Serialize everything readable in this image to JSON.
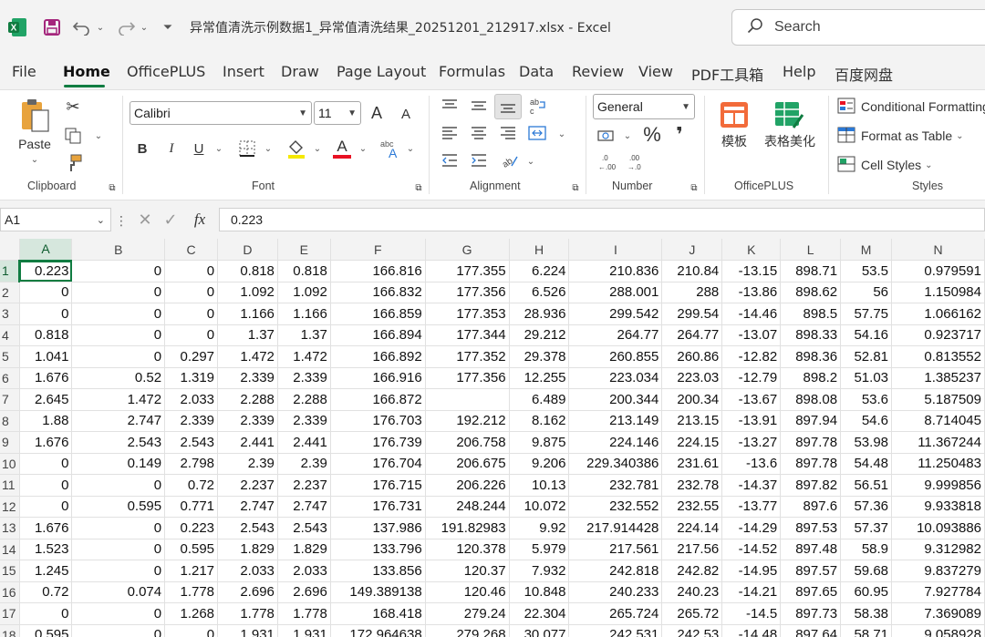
{
  "window": {
    "title": "异常值清洗示例数据1_异常值清洗结果_20251201_212917.xlsx  -  Excel",
    "search_placeholder": "Search"
  },
  "tabs": [
    {
      "label": "File"
    },
    {
      "label": "Home",
      "active": true
    },
    {
      "label": "OfficePLUS"
    },
    {
      "label": "Insert"
    },
    {
      "label": "Draw"
    },
    {
      "label": "Page Layout"
    },
    {
      "label": "Formulas"
    },
    {
      "label": "Data"
    },
    {
      "label": "Review"
    },
    {
      "label": "View"
    },
    {
      "label": "PDF工具箱"
    },
    {
      "label": "Help"
    },
    {
      "label": "百度网盘"
    }
  ],
  "ribbon": {
    "clipboard": {
      "paste_label": "Paste",
      "group_label": "Clipboard"
    },
    "font": {
      "family": "Calibri",
      "size": "11",
      "group_label": "Font",
      "bold": "B",
      "italic": "I",
      "underline": "U",
      "grow": "A",
      "shrink": "A",
      "font_color": "A"
    },
    "alignment": {
      "group_label": "Alignment"
    },
    "number": {
      "format": "General",
      "group_label": "Number",
      "percent": "%",
      "comma": "❜"
    },
    "officeplus": {
      "template_label": "模板",
      "beautify_label": "表格美化",
      "group_label": "OfficePLUS"
    },
    "styles": {
      "conditional": "Conditional Formatting",
      "format_table": "Format as Table",
      "cell_styles": "Cell Styles",
      "group_label": "Styles"
    }
  },
  "formula_bar": {
    "name_box": "A1",
    "fx": "fx",
    "value": "0.223"
  },
  "sheet": {
    "columns": [
      "A",
      "B",
      "C",
      "D",
      "E",
      "F",
      "G",
      "H",
      "I",
      "J",
      "K",
      "L",
      "M",
      "N"
    ],
    "rows": [
      {
        "num": "1",
        "cells": [
          "0.223",
          "0",
          "0",
          "0.818",
          "0.818",
          "166.816",
          "177.355",
          "6.224",
          "210.836",
          "210.84",
          "-13.15",
          "898.71",
          "53.5",
          "0.979591"
        ]
      },
      {
        "num": "2",
        "cells": [
          "0",
          "0",
          "0",
          "1.092",
          "1.092",
          "166.832",
          "177.356",
          "6.526",
          "288.001",
          "288",
          "-13.86",
          "898.62",
          "56",
          "1.150984"
        ]
      },
      {
        "num": "3",
        "cells": [
          "0",
          "0",
          "0",
          "1.166",
          "1.166",
          "166.859",
          "177.353",
          "28.936",
          "299.542",
          "299.54",
          "-14.46",
          "898.5",
          "57.75",
          "1.066162"
        ]
      },
      {
        "num": "4",
        "cells": [
          "0.818",
          "0",
          "0",
          "1.37",
          "1.37",
          "166.894",
          "177.344",
          "29.212",
          "264.77",
          "264.77",
          "-13.07",
          "898.33",
          "54.16",
          "0.923717"
        ]
      },
      {
        "num": "5",
        "cells": [
          "1.041",
          "0",
          "0.297",
          "1.472",
          "1.472",
          "166.892",
          "177.352",
          "29.378",
          "260.855",
          "260.86",
          "-12.82",
          "898.36",
          "52.81",
          "0.813552"
        ]
      },
      {
        "num": "6",
        "cells": [
          "1.676",
          "0.52",
          "1.319",
          "2.339",
          "2.339",
          "166.916",
          "177.356",
          "12.255",
          "223.034",
          "223.03",
          "-12.79",
          "898.2",
          "51.03",
          "1.385237"
        ]
      },
      {
        "num": "7",
        "cells": [
          "2.645",
          "1.472",
          "2.033",
          "2.288",
          "2.288",
          "166.872",
          "",
          "6.489",
          "200.344",
          "200.34",
          "-13.67",
          "898.08",
          "53.6",
          "5.187509"
        ]
      },
      {
        "num": "8",
        "cells": [
          "1.88",
          "2.747",
          "2.339",
          "2.339",
          "2.339",
          "176.703",
          "192.212",
          "8.162",
          "213.149",
          "213.15",
          "-13.91",
          "897.94",
          "54.6",
          "8.714045"
        ]
      },
      {
        "num": "9",
        "cells": [
          "1.676",
          "2.543",
          "2.543",
          "2.441",
          "2.441",
          "176.739",
          "206.758",
          "9.875",
          "224.146",
          "224.15",
          "-13.27",
          "897.78",
          "53.98",
          "11.367244"
        ]
      },
      {
        "num": "10",
        "cells": [
          "0",
          "0.149",
          "2.798",
          "2.39",
          "2.39",
          "176.704",
          "206.675",
          "9.206",
          "229.340386",
          "231.61",
          "-13.6",
          "897.78",
          "54.48",
          "11.250483"
        ]
      },
      {
        "num": "11",
        "cells": [
          "0",
          "0",
          "0.72",
          "2.237",
          "2.237",
          "176.715",
          "206.226",
          "10.13",
          "232.781",
          "232.78",
          "-14.37",
          "897.82",
          "56.51",
          "9.999856"
        ]
      },
      {
        "num": "12",
        "cells": [
          "0",
          "0.595",
          "0.771",
          "2.747",
          "2.747",
          "176.731",
          "248.244",
          "10.072",
          "232.552",
          "232.55",
          "-13.77",
          "897.6",
          "57.36",
          "9.933818"
        ]
      },
      {
        "num": "13",
        "cells": [
          "1.676",
          "0",
          "0.223",
          "2.543",
          "2.543",
          "137.986",
          "191.82983",
          "9.92",
          "217.914428",
          "224.14",
          "-14.29",
          "897.53",
          "57.37",
          "10.093886"
        ]
      },
      {
        "num": "14",
        "cells": [
          "1.523",
          "0",
          "0.595",
          "1.829",
          "1.829",
          "133.796",
          "120.378",
          "5.979",
          "217.561",
          "217.56",
          "-14.52",
          "897.48",
          "58.9",
          "9.312982"
        ]
      },
      {
        "num": "15",
        "cells": [
          "1.245",
          "0",
          "1.217",
          "2.033",
          "2.033",
          "133.856",
          "120.37",
          "7.932",
          "242.818",
          "242.82",
          "-14.95",
          "897.57",
          "59.68",
          "9.837279"
        ]
      },
      {
        "num": "16",
        "cells": [
          "0.72",
          "0.074",
          "1.778",
          "2.696",
          "2.696",
          "149.389138",
          "120.46",
          "10.848",
          "240.233",
          "240.23",
          "-14.21",
          "897.65",
          "60.95",
          "7.927784"
        ]
      },
      {
        "num": "17",
        "cells": [
          "0",
          "0",
          "1.268",
          "1.778",
          "1.778",
          "168.418",
          "279.24",
          "22.304",
          "265.724",
          "265.72",
          "-14.5",
          "897.73",
          "58.38",
          "7.369089"
        ]
      },
      {
        "num": "18",
        "cells": [
          "0.595",
          "0",
          "0",
          "1.931",
          "1.931",
          "172.964638",
          "279.268",
          "30.077",
          "242.531",
          "242.53",
          "-14.48",
          "897.64",
          "58.71",
          "9.058928"
        ]
      }
    ]
  }
}
